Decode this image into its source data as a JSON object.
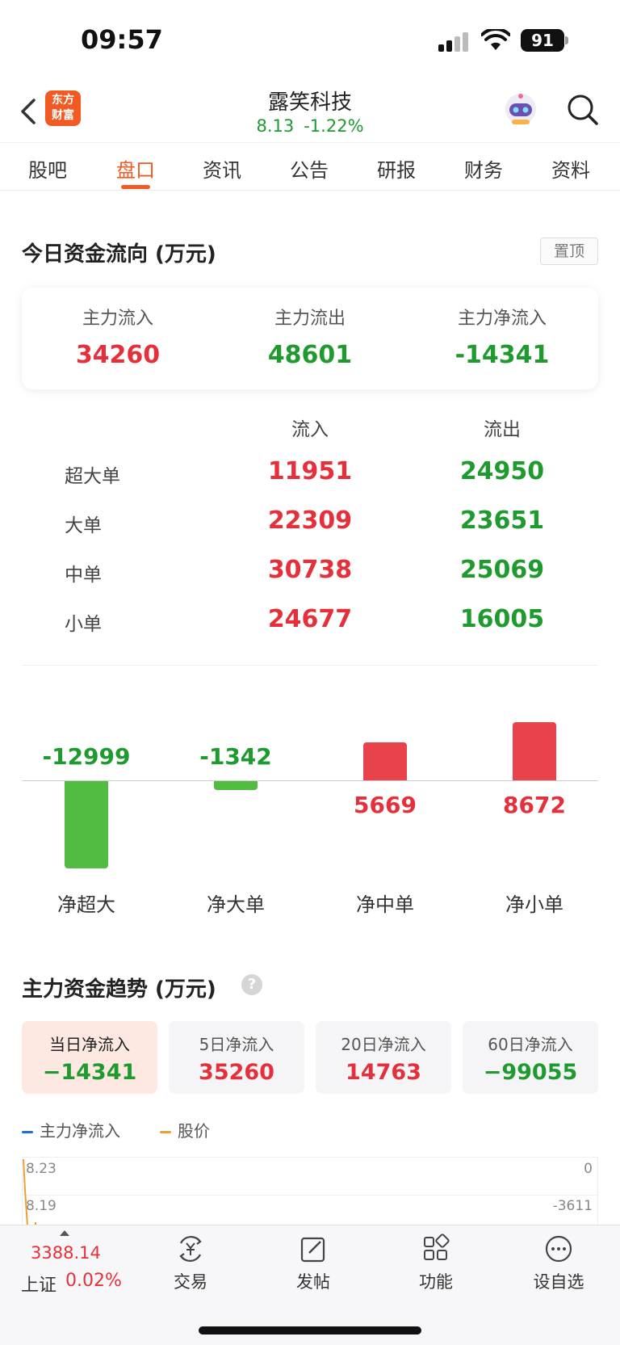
{
  "status_bar": {
    "time": "09:57",
    "battery": "91"
  },
  "header": {
    "logo_line1": "东方",
    "logo_line2": "财富",
    "stock_name": "露笑科技",
    "price": "8.13",
    "change_pct": "-1.22%"
  },
  "tabs": [
    "股吧",
    "盘口",
    "资讯",
    "公告",
    "研报",
    "财务",
    "资料"
  ],
  "active_tab": "盘口",
  "capital_flow": {
    "title": "今日资金流向 (万元)",
    "pin_label": "置顶",
    "summary": [
      {
        "label": "主力流入",
        "value": "34260"
      },
      {
        "label": "主力流出",
        "value": "48601"
      },
      {
        "label": "主力净流入",
        "value": "-14341"
      }
    ],
    "table": {
      "headers": [
        "流入",
        "流出"
      ],
      "rows": [
        {
          "label": "超大单",
          "inflow": "11951",
          "outflow": "24950"
        },
        {
          "label": "大单",
          "inflow": "22309",
          "outflow": "23651"
        },
        {
          "label": "中单",
          "inflow": "30738",
          "outflow": "25069"
        },
        {
          "label": "小单",
          "inflow": "24677",
          "outflow": "16005"
        }
      ]
    }
  },
  "chart_data": {
    "type": "bar",
    "categories": [
      "净超大",
      "净大单",
      "净中单",
      "净小单"
    ],
    "values": [
      -12999,
      -1342,
      5669,
      8672
    ],
    "value_labels": [
      "-12999",
      "-1342",
      "5669",
      "8672"
    ],
    "colors": {
      "positive": "#e8434a",
      "negative": "#52bb42"
    }
  },
  "trend": {
    "title": "主力资金趋势 (万元)",
    "cards": [
      {
        "label": "当日净流入",
        "value": "−14341"
      },
      {
        "label": "5日净流入",
        "value": "35260"
      },
      {
        "label": "20日净流入",
        "value": "14763"
      },
      {
        "label": "60日净流入",
        "value": "−99055"
      }
    ],
    "legend": [
      "主力净流入",
      "股价"
    ],
    "legend_colors": [
      "#1f6fd6",
      "#f0a030"
    ],
    "y_left_ticks": [
      "8.23",
      "8.19"
    ],
    "y_right_ticks": [
      "0",
      "-3611"
    ]
  },
  "bottom_nav": {
    "index_value": "3388.14",
    "index_name": "上证",
    "index_change": "0.02%",
    "items": [
      "交易",
      "发帖",
      "功能",
      "设自选"
    ]
  }
}
